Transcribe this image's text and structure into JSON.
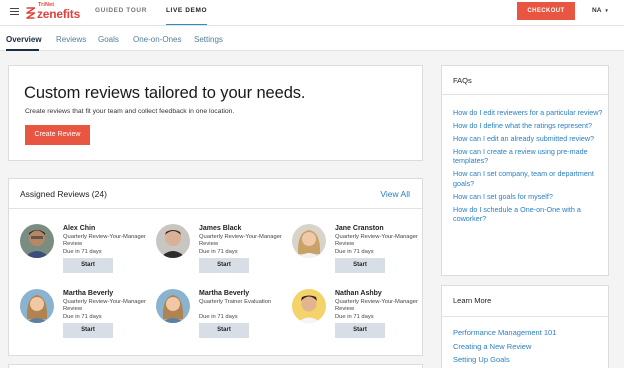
{
  "brand": {
    "small": "TriNet",
    "name": "zenefits",
    "color": "#e2423b"
  },
  "topnav": [
    {
      "label": "GUIDED TOUR",
      "active": false
    },
    {
      "label": "LIVE DEMO",
      "active": true
    }
  ],
  "checkout_label": "CHECKOUT",
  "region": "NA",
  "tabs": [
    {
      "label": "Overview",
      "active": true
    },
    {
      "label": "Reviews",
      "active": false
    },
    {
      "label": "Goals",
      "active": false
    },
    {
      "label": "One-on-Ones",
      "active": false
    },
    {
      "label": "Settings",
      "active": false
    }
  ],
  "hero": {
    "title": "Custom reviews tailored to your needs.",
    "subtitle": "Create reviews that fit your team and collect feedback in one location.",
    "button": "Create Review"
  },
  "assigned": {
    "title": "Assigned Reviews (24)",
    "view_all": "View All",
    "items": [
      {
        "name": "Alex Chin",
        "type": "Quarterly Review-Your-Manager Review",
        "due": "Due in 71 days",
        "action": "Start",
        "avatar": "avatar-alex"
      },
      {
        "name": "James Black",
        "type": "Quarterly Review-Your-Manager Review",
        "due": "Due in 71 days",
        "action": "Start",
        "avatar": "avatar-james"
      },
      {
        "name": "Jane Cranston",
        "type": "Quarterly Review-Your-Manager Review",
        "due": "Due in 71 days",
        "action": "Start",
        "avatar": "avatar-jane"
      },
      {
        "name": "Martha Beverly",
        "type": "Quarterly Review-Your-Manager Review",
        "due": "Due in 71 days",
        "action": "Start",
        "avatar": "avatar-martha"
      },
      {
        "name": "Martha Beverly",
        "type": "Quarterly Trainer Evaluation",
        "due": "Due in 71 days",
        "action": "Start",
        "avatar": "avatar-martha"
      },
      {
        "name": "Nathan Ashby",
        "type": "Quarterly Review-Your-Manager Review",
        "due": "Due in 71 days",
        "action": "Start",
        "avatar": "avatar-nathan"
      }
    ]
  },
  "faqs": {
    "title": "FAQs",
    "items": [
      "How do I edit reviewers for a particular review?",
      "How do I define what the ratings represent?",
      "How can I edit an already submitted review?",
      "How can I create a review using pre-made templates?",
      "How can I set company, team or department goals?",
      "How can I set goals for myself?",
      "How do I schedule a One-on-One with a coworker?"
    ]
  },
  "learn_more": {
    "title": "Learn More",
    "items": [
      "Performance Management 101",
      "Creating a New Review",
      "Setting Up Goals"
    ]
  },
  "colors": {
    "accent": "#e85541",
    "link": "#2a7fc1",
    "active_tab": "#1c2d3e",
    "start_button": "#d8dee6"
  }
}
